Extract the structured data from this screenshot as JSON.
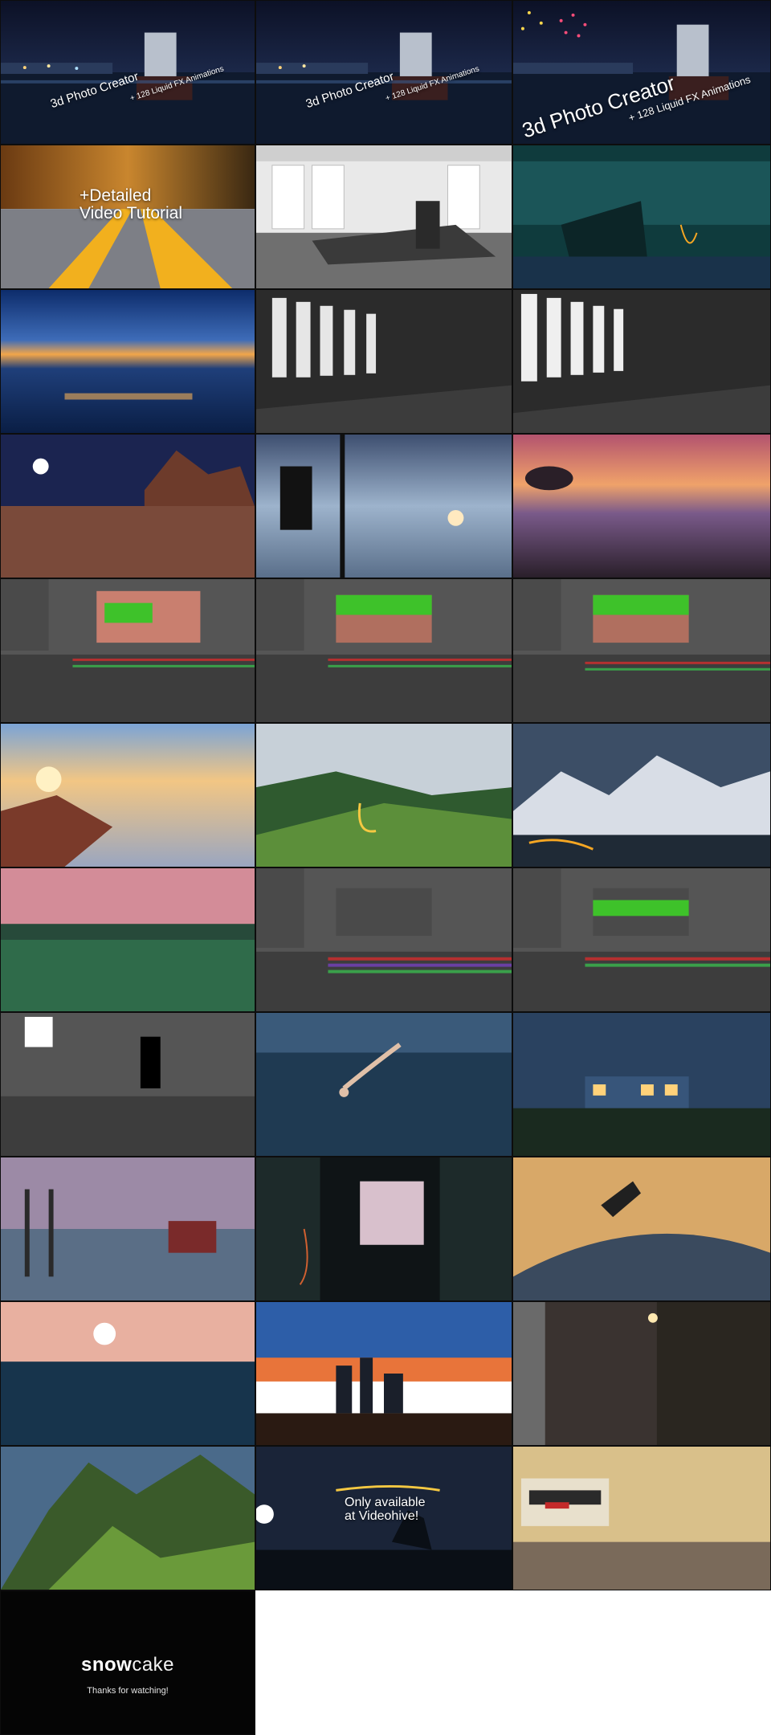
{
  "preview_captions": {
    "product_small": "3d Photo Creator",
    "addon_small": "+ 128 Liquid FX Animations",
    "product_large": "3d Photo Creator",
    "addon_large": "+ 128 Liquid FX Animations",
    "tutorial": "+Detailed\nVideo Tutorial",
    "availability": "Only available\nat Videohive!"
  },
  "brand": {
    "logo_bold": "snow",
    "logo_light": "cake",
    "tagline": "Thanks for watching!"
  },
  "accent_colors": {
    "liquid_fx": "#f5a623",
    "green_screen": "#3ec22a",
    "timeline_red": "#b53030"
  }
}
